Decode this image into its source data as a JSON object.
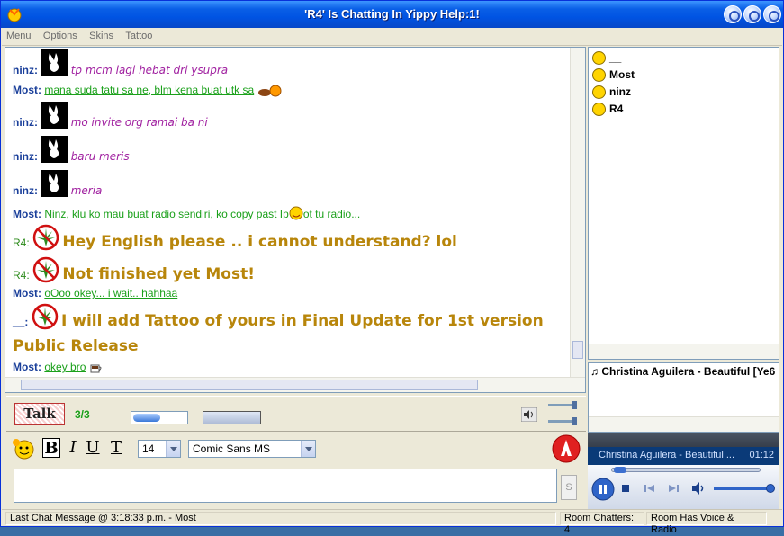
{
  "window": {
    "title": "'R4' Is Chatting In Yippy Help:1!"
  },
  "menu": [
    "Menu",
    "Options",
    "Skins",
    "Tattoo"
  ],
  "messages": [
    {
      "nick": "ninz:",
      "text": "tp mcm lagi hebat dri ysupra"
    },
    {
      "nick": "Most:",
      "text": "mana suda tatu sa ne, blm kena buat utk sa"
    },
    {
      "nick": "ninz:",
      "text": "mo invite org ramai ba ni"
    },
    {
      "nick": "ninz:",
      "text": "baru meris"
    },
    {
      "nick": "ninz:",
      "text": "meria"
    },
    {
      "nick": "Most:",
      "text": "Ninz, klu ko mau buat radio sendiri, ko copy past Ip",
      "text2": "ot tu radio..."
    },
    {
      "nick": "R4:",
      "text": "Hey English please .. i cannot understand? lol"
    },
    {
      "nick": "R4:",
      "text": "Not finished yet Most!"
    },
    {
      "nick": "Most:",
      "text": "oOoo okey... i wait.. hahhaa"
    },
    {
      "nick": "__:",
      "text": "I will add Tattoo of yours in Final Update for 1st version",
      "text2": "Public Release"
    },
    {
      "nick": "Most:",
      "text": "okey bro"
    }
  ],
  "users": [
    "__",
    "Most",
    "ninz",
    "R4"
  ],
  "radio": {
    "track": "Christina Aguilera - Beautiful [Ye6"
  },
  "player": {
    "now_playing": "Christina Aguilera - Beautiful ...",
    "time": "01:12"
  },
  "controls": {
    "talk_label": "Talk",
    "count": "3/3"
  },
  "format": {
    "bold": "B",
    "italic": "I",
    "underline": "U",
    "color_t": "T",
    "size": "14",
    "font": "Comic Sans MS",
    "send_label": "S"
  },
  "status": {
    "last_message": "Last Chat Message @ 3:18:33 p.m. - Most",
    "room_chatters": "Room Chatters: 4",
    "voice": "Room Has Voice & Radio"
  },
  "colors": {
    "titlebar": "#0054e3",
    "nick": "#1a3f9a",
    "purple_msg": "#a020a0",
    "green_msg": "#1aa01a",
    "big_msg": "#b8860b"
  }
}
